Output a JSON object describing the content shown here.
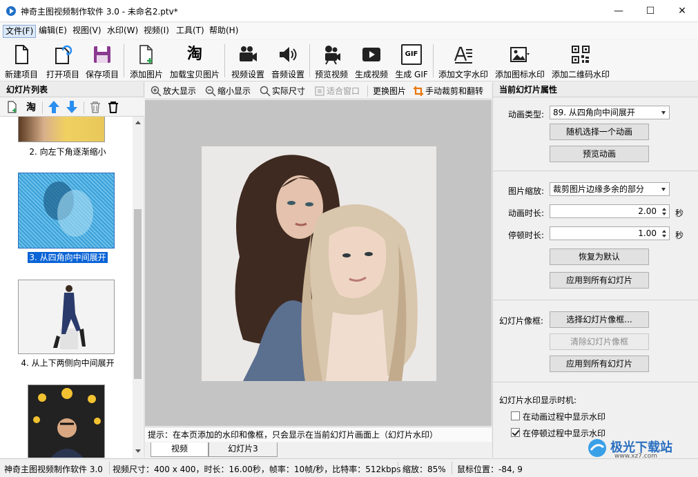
{
  "window": {
    "title": "神奇主图视频制作软件 3.0 - 未命名2.ptv*",
    "minimize": "—",
    "maximize": "☐",
    "close": "✕"
  },
  "menu": [
    "文件(F)",
    "编辑(E)",
    "视图(V)",
    "水印(W)",
    "视频(I)",
    "工具(T)",
    "帮助(H)"
  ],
  "toolbar": [
    {
      "label": "新建项目",
      "icon": "new-project-icon"
    },
    {
      "label": "打开项目",
      "icon": "open-project-icon"
    },
    {
      "label": "保存项目",
      "icon": "save-project-icon"
    },
    {
      "label": "添加图片",
      "icon": "add-image-icon"
    },
    {
      "label": "加载宝贝图片",
      "icon": "taobao-icon"
    },
    {
      "label": "视频设置",
      "icon": "video-camera-icon"
    },
    {
      "label": "音频设置",
      "icon": "speaker-icon"
    },
    {
      "label": "预览视频",
      "icon": "movie-camera-icon"
    },
    {
      "label": "生成视频",
      "icon": "video-play-icon"
    },
    {
      "label": "生成 GIF",
      "icon": "gif-icon"
    },
    {
      "label": "添加文字水印",
      "icon": "text-watermark-icon"
    },
    {
      "label": "添加图标水印",
      "icon": "image-watermark-icon"
    },
    {
      "label": "添加二维码水印",
      "icon": "qrcode-icon"
    }
  ],
  "taobao_glyph": "淘",
  "gif_glyph": "GIF",
  "left_panel": {
    "title": "幻灯片列表",
    "slides": [
      {
        "label": "2. 向左下角逐渐缩小"
      },
      {
        "label": "3. 从四角向中间展开"
      },
      {
        "label": "4. 从上下两侧向中间展开"
      }
    ]
  },
  "center": {
    "tools": [
      "放大显示",
      "缩小显示",
      "实际尺寸",
      "适合窗口",
      "更换图片",
      "手动裁剪和翻转"
    ],
    "hint": "提示：在本页添加的水印和像框，只会显示在当前幻灯片画面上（幻灯片水印）",
    "tabs": [
      "视频",
      "幻灯片3"
    ]
  },
  "right_panel": {
    "title": "当前幻灯片属性",
    "animation_type_label": "动画类型:",
    "animation_type_value": "89. 从四角向中间展开",
    "random_button": "随机选择一个动画",
    "preview_button": "预览动画",
    "scale_label": "图片缩放:",
    "scale_value": "裁剪图片边缘多余的部分",
    "anim_duration_label": "动画时长:",
    "anim_duration_value": "2.00",
    "pause_duration_label": "停顿时长:",
    "pause_duration_value": "1.00",
    "seconds_unit": "秒",
    "reset_button": "恢复为默认",
    "apply_all_button": "应用到所有幻灯片",
    "frame_label": "幻灯片像框:",
    "choose_frame_button": "选择幻灯片像框...",
    "clear_frame_button": "清除幻灯片像框",
    "apply_all_frame_button": "应用到所有幻灯片",
    "watermark_timing_label": "幻灯片水印显示时机:",
    "show_during_animation": "在动画过程中显示水印",
    "show_during_animation_checked": false,
    "show_during_pause": "在停顿过程中显示水印",
    "show_during_pause_checked": true
  },
  "status": {
    "app": "神奇主图视频制作软件 3.0",
    "video_info": "视频尺寸：400 x 400，时长：16.00秒，帧率：10帧/秒，比特率：512kbps",
    "zoom": "缩放：85%",
    "mouse": "鼠标位置：-84, 9"
  },
  "watermark_text": "极光下载站",
  "watermark_url": "www.xz7.com",
  "colors": {
    "accent": "#0a64d6",
    "arrow_blue": "#2a8ef0",
    "toolbar_icon": "#222222",
    "gray_bg": "#c4c4c4"
  }
}
